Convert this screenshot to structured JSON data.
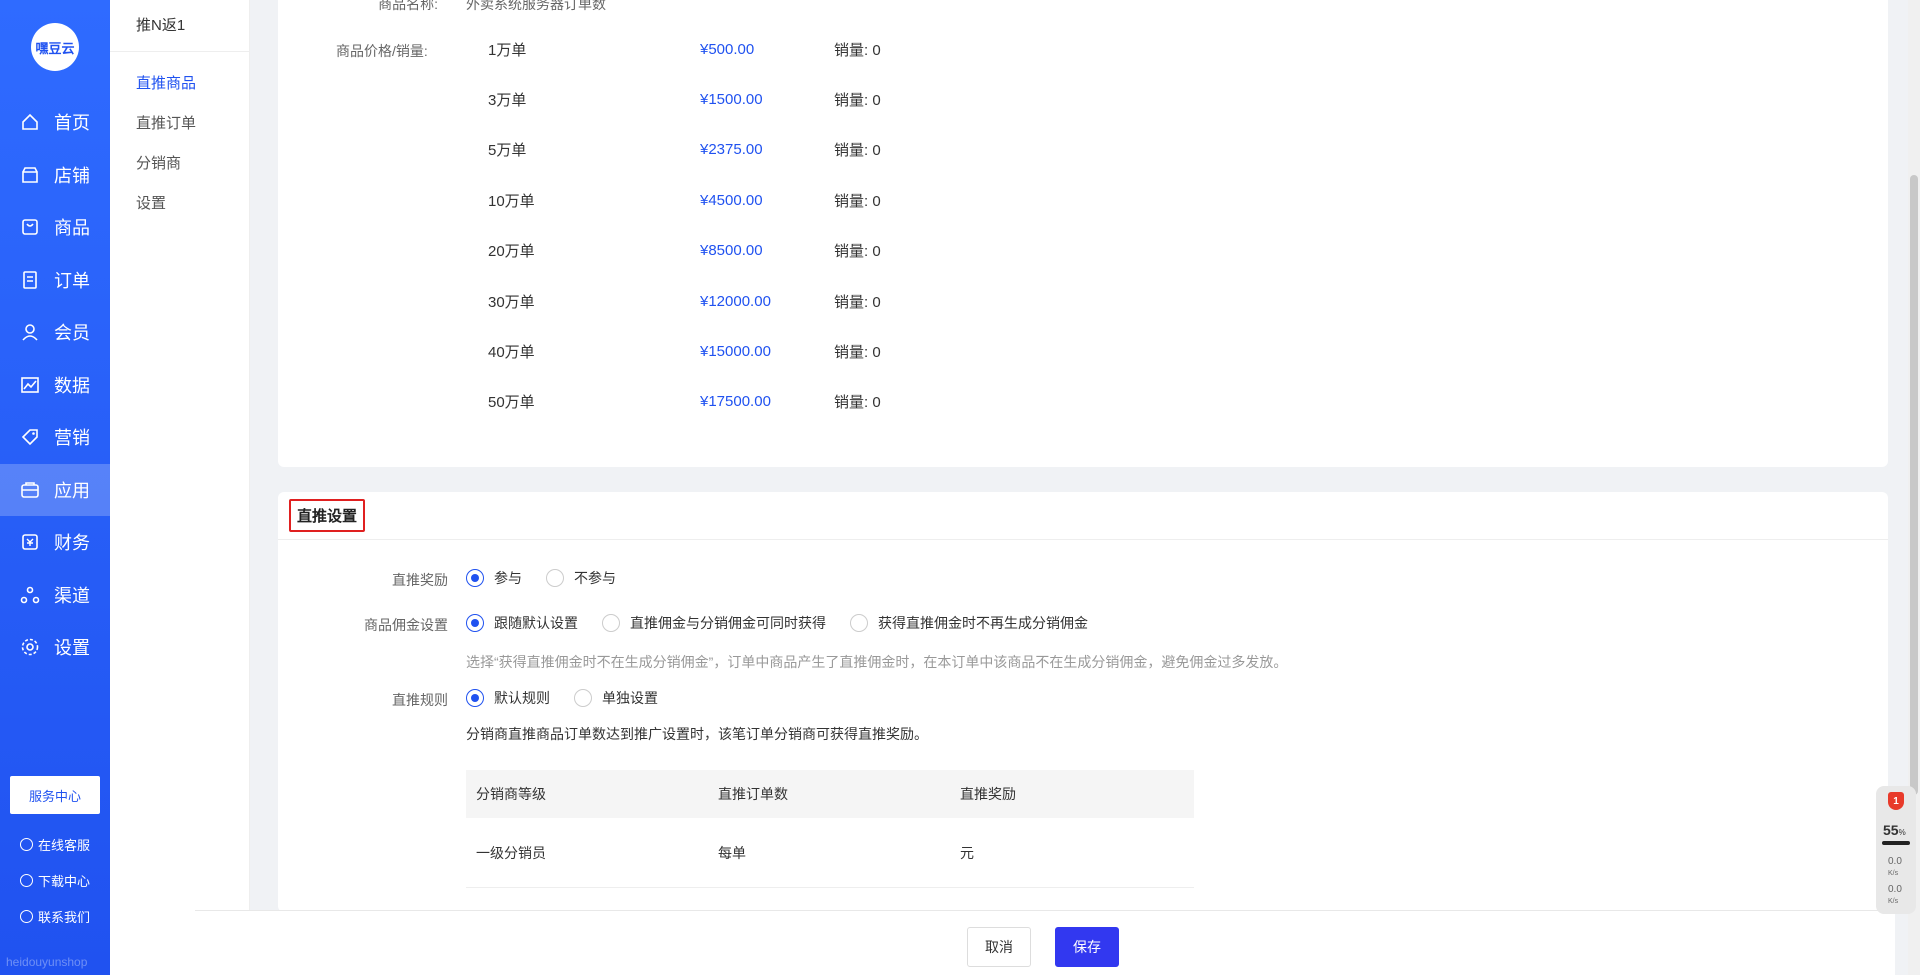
{
  "app": {
    "logo_text": "嘿豆云",
    "watermark": "heidouyunshop",
    "brand_color": "#2052f0"
  },
  "sidebar": {
    "items": [
      {
        "label": "首页",
        "icon": "home-icon"
      },
      {
        "label": "店铺",
        "icon": "store-icon"
      },
      {
        "label": "商品",
        "icon": "goods-icon"
      },
      {
        "label": "订单",
        "icon": "order-icon"
      },
      {
        "label": "会员",
        "icon": "member-icon"
      },
      {
        "label": "数据",
        "icon": "chart-icon"
      },
      {
        "label": "营销",
        "icon": "tag-icon"
      },
      {
        "label": "应用",
        "icon": "app-icon",
        "active": true
      },
      {
        "label": "财务",
        "icon": "finance-icon"
      },
      {
        "label": "渠道",
        "icon": "channel-icon"
      },
      {
        "label": "设置",
        "icon": "gear-icon"
      }
    ],
    "service_center": "服务中心",
    "links": [
      "在线客服",
      "下载中心",
      "联系我们"
    ]
  },
  "submenu": {
    "title": "推N返1",
    "items": [
      "直推商品",
      "直推订单",
      "分销商",
      "设置"
    ],
    "active": "直推商品"
  },
  "product": {
    "name_label": "商品名称:",
    "name_value": "外卖系统服务器订单数",
    "price_label": "商品价格/销量:",
    "sales_prefix": "销量:",
    "rows": [
      {
        "spec": "1万单",
        "price": "¥500.00",
        "sales": "0"
      },
      {
        "spec": "3万单",
        "price": "¥1500.00",
        "sales": "0"
      },
      {
        "spec": "5万单",
        "price": "¥2375.00",
        "sales": "0"
      },
      {
        "spec": "10万单",
        "price": "¥4500.00",
        "sales": "0"
      },
      {
        "spec": "20万单",
        "price": "¥8500.00",
        "sales": "0"
      },
      {
        "spec": "30万单",
        "price": "¥12000.00",
        "sales": "0"
      },
      {
        "spec": "40万单",
        "price": "¥15000.00",
        "sales": "0"
      },
      {
        "spec": "50万单",
        "price": "¥17500.00",
        "sales": "0"
      }
    ]
  },
  "direct_settings": {
    "title": "直推设置",
    "reward": {
      "label": "直推奖励",
      "options": [
        "参与",
        "不参与"
      ],
      "selected": 0
    },
    "commission": {
      "label": "商品佣金设置",
      "options": [
        "跟随默认设置",
        "直推佣金与分销佣金可同时获得",
        "获得直推佣金时不再生成分销佣金"
      ],
      "selected": 0,
      "hint": "选择“获得直推佣金时不在生成分销佣金”，订单中商品产生了直推佣金时，在本订单中该商品不在生成分销佣金，避免佣金过多发放。"
    },
    "rule": {
      "label": "直推规则",
      "options": [
        "默认规则",
        "单独设置"
      ],
      "selected": 0,
      "hint": "分销商直推商品订单数达到推广设置时，该笔订单分销商可获得直推奖励。"
    },
    "table": {
      "headers": [
        "分销商等级",
        "直推订单数",
        "直推奖励"
      ],
      "rows": [
        [
          "一级分销员",
          "每单",
          "元"
        ]
      ]
    }
  },
  "footer": {
    "cancel": "取消",
    "save": "保存"
  },
  "monitor": {
    "badge": "1",
    "percent": "55",
    "percent_unit": "%",
    "up": "0.0",
    "down": "0.0",
    "unit": "K/s"
  }
}
